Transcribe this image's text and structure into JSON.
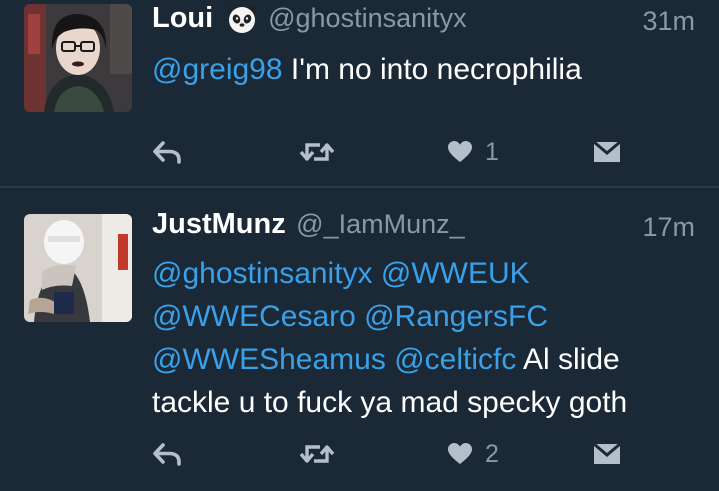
{
  "tweets": [
    {
      "display_name": "Loui",
      "emoji_icon": "panda-emoji",
      "handle": "@ghostinsanityx",
      "time": "31m",
      "text_parts": [
        {
          "text": "@greig98",
          "mention": true
        },
        {
          "text": " I'm no into necrophilia",
          "mention": false
        }
      ],
      "likes": "1"
    },
    {
      "display_name": "JustMunz",
      "handle": "@_IamMunz_",
      "time": "17m",
      "text_parts": [
        {
          "text": "@ghostinsanityx",
          "mention": true
        },
        {
          "text": " ",
          "mention": false
        },
        {
          "text": "@WWEUK",
          "mention": true
        },
        {
          "text": " ",
          "mention": false
        },
        {
          "text": "@WWECesaro",
          "mention": true
        },
        {
          "text": " ",
          "mention": false
        },
        {
          "text": "@RangersFC",
          "mention": true
        },
        {
          "text": " ",
          "mention": false
        },
        {
          "text": "@WWESheamus",
          "mention": true
        },
        {
          "text": " ",
          "mention": false
        },
        {
          "text": "@celticfc",
          "mention": true
        },
        {
          "text": " Al slide tackle u to fuck ya mad specky goth",
          "mention": false
        }
      ],
      "likes": "2"
    }
  ],
  "colors": {
    "background": "#1b2836",
    "divider": "#2c3b4a",
    "mention": "#3aa0e8",
    "secondary_text": "#8899a6",
    "action_icon": "#b4bfca"
  }
}
